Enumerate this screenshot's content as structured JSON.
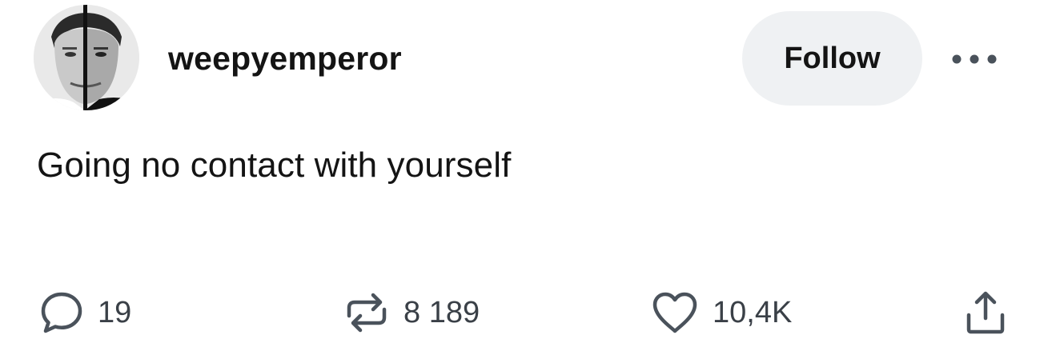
{
  "post": {
    "username": "weepyemperor",
    "follow_label": "Follow",
    "text": "Going no contact with yourself",
    "actions": {
      "replies": "19",
      "reposts": "8 189",
      "likes": "10,4K"
    }
  },
  "icons": {
    "avatar": "avatar-portrait",
    "more": "more-dots-icon",
    "reply": "speech-bubble-icon",
    "repost": "repost-arrows-icon",
    "like": "heart-icon",
    "share": "share-upload-icon"
  },
  "colors": {
    "follow_bg": "#eff1f3",
    "icon": "#4a525b",
    "text": "#141414"
  }
}
